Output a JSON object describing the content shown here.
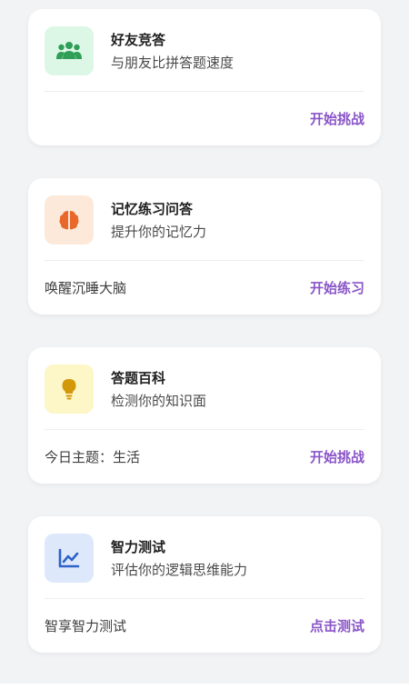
{
  "colors": {
    "accent": "#8a56c8",
    "bg": "#f2f3f5"
  },
  "cards": [
    {
      "icon": "group-icon",
      "icon_bg": "#dcf7e6",
      "icon_color": "#2f9e57",
      "title": "好友竞答",
      "subtitle": "与朋友比拼答题速度",
      "bottom_left": "",
      "action": "开始挑战"
    },
    {
      "icon": "brain-icon",
      "icon_bg": "#fde9d9",
      "icon_color": "#e8672b",
      "title": "记忆练习问答",
      "subtitle": "提升你的记忆力",
      "bottom_left": "唤醒沉睡大脑",
      "action": "开始练习"
    },
    {
      "icon": "lightbulb-icon",
      "icon_bg": "#fdf6c6",
      "icon_color": "#d3970a",
      "title": "答题百科",
      "subtitle": "检测你的知识面",
      "bottom_left": "今日主题：生活",
      "action": "开始挑战"
    },
    {
      "icon": "chart-line-icon",
      "icon_bg": "#dde9fb",
      "icon_color": "#2d63c8",
      "title": "智力测试",
      "subtitle": "评估你的逻辑思维能力",
      "bottom_left": "智享智力测试",
      "action": "点击测试"
    }
  ]
}
